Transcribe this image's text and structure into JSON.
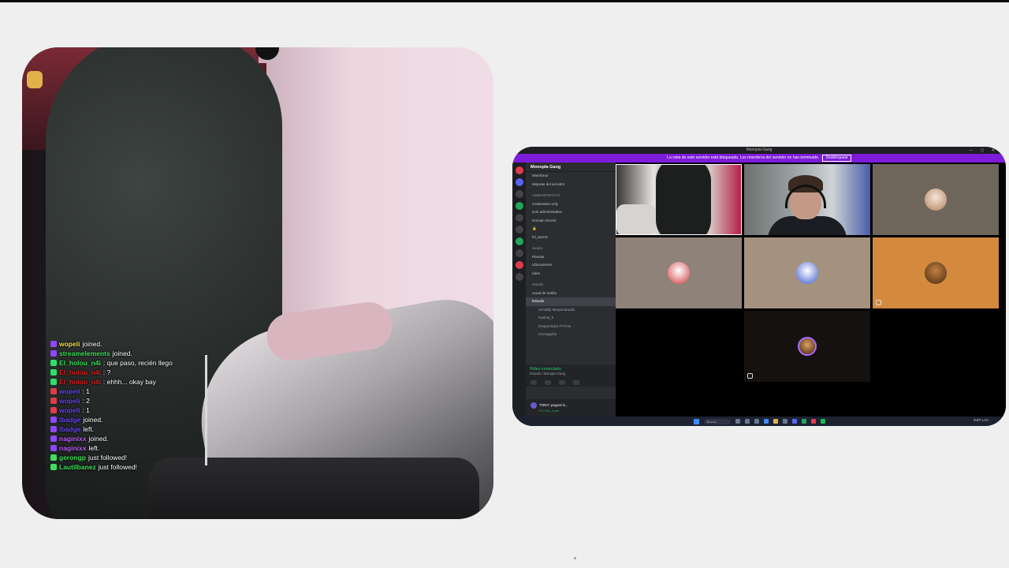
{
  "chat": [
    {
      "user": "wopeli",
      "user_color": "#f3e03b",
      "text": "joined.",
      "badge_color": "#9146ff"
    },
    {
      "user": "streamelements",
      "user_color": "#3ee05a",
      "text": "joined.",
      "badge_color": "#9146ff"
    },
    {
      "user": "El_holou_n4i",
      "user_color": "#3ee05a",
      "text": ": que paso, recién llego",
      "badge_color": "#2ee06a"
    },
    {
      "user": "El_holou_n4i",
      "user_color": "#e02020",
      "text": ": ?",
      "badge_color": "#2ee06a"
    },
    {
      "user": "El_holou_n4i",
      "user_color": "#e02020",
      "text": ": ehhh... okay bay",
      "badge_color": "#2ee06a"
    },
    {
      "user": "wopeli",
      "user_color": "#6b44ff",
      "text": ": 1",
      "badge_color": "#e03b4a"
    },
    {
      "user": "wopeli",
      "user_color": "#6b44ff",
      "text": ": 2",
      "badge_color": "#e03b4a"
    },
    {
      "user": "wopeli",
      "user_color": "#6b44ff",
      "text": ": 1",
      "badge_color": "#e03b4a"
    },
    {
      "user": "lbadge",
      "user_color": "#6b44ff",
      "text": "joined.",
      "badge_color": "#9146ff"
    },
    {
      "user": "lbadge",
      "user_color": "#6b44ff",
      "text": "left.",
      "badge_color": "#9146ff"
    },
    {
      "user": "naginixx",
      "user_color": "#c35cff",
      "text": "joined.",
      "badge_color": "#9146ff"
    },
    {
      "user": "naginixx",
      "user_color": "#c35cff",
      "text": "left.",
      "badge_color": "#9146ff"
    },
    {
      "user": "gerongp",
      "user_color": "#3ee05a",
      "text": "just followed!",
      "badge_color": "#3ee05a"
    },
    {
      "user": "LautiIbanez",
      "user_color": "#3ee05a",
      "text": "just followed!",
      "badge_color": "#3ee05a"
    }
  ],
  "discord": {
    "window_title": "Monopla Gang",
    "notice": "La vista de este servidor está bloqueada. Los miembros del servidor no han terminado.",
    "notice_button": "Desbloquear",
    "server_name": "Monopla Gang",
    "channels": [
      {
        "label": "Miembros",
        "kind": "normal"
      },
      {
        "label": "Mejoras del servidor",
        "kind": "normal"
      },
      {
        "label": "ADMINISTRATIVO",
        "kind": "cat"
      },
      {
        "label": "moderation-only",
        "kind": "normal"
      },
      {
        "label": "solo administrativo",
        "kind": "normal"
      },
      {
        "label": "Domain Secret",
        "kind": "normal"
      },
      {
        "label": "🔒",
        "kind": "normal"
      },
      {
        "label": "lol_secret",
        "kind": "normal"
      },
      {
        "label": "Juegos",
        "kind": "cat"
      },
      {
        "label": "Plantas",
        "kind": "normal"
      },
      {
        "label": "Ubicaciones",
        "kind": "normal"
      },
      {
        "label": "rules",
        "kind": "normal"
      },
      {
        "label": "Estudio",
        "kind": "cat"
      },
      {
        "label": "canal de tortilla",
        "kind": "normal"
      },
      {
        "label": "Estudio",
        "kind": "active"
      },
      {
        "label": "Scrolldy Mequinabadis",
        "kind": "sub"
      },
      {
        "label": "Nashul_k",
        "kind": "sub"
      },
      {
        "label": "Despertador PYTHs",
        "kind": "sub"
      },
      {
        "label": "nicmaguilar",
        "kind": "sub"
      }
    ],
    "voice_status": "Video conectado",
    "voice_channel": "Estudio / Monopla Gang",
    "user_name": "TONY: pogcor b...",
    "user_status": "EN Fwk, mute"
  },
  "taskbar": {
    "search_label": "Buscar",
    "tray_text": "ESP LAA"
  }
}
